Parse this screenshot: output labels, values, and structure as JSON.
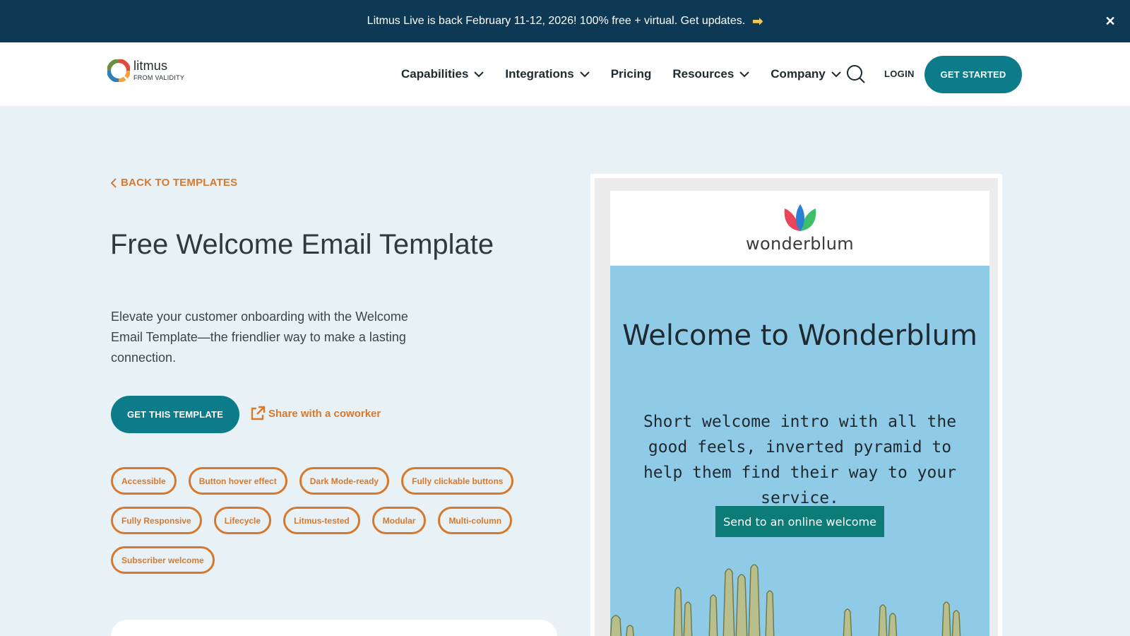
{
  "announcement": {
    "text": "Litmus Live is back February 11-12, 2026! 100% free + virtual. Get updates.",
    "arrow": "➡",
    "close": "✕"
  },
  "header": {
    "logo_name": "litmus",
    "logo_sub": "FROM VALIDITY",
    "nav": [
      {
        "label": "Capabilities",
        "dropdown": true
      },
      {
        "label": "Integrations",
        "dropdown": true
      },
      {
        "label": "Pricing",
        "dropdown": false
      },
      {
        "label": "Resources",
        "dropdown": true
      },
      {
        "label": "Company",
        "dropdown": true
      }
    ],
    "login": "LOGIN",
    "get_started": "GET STARTED"
  },
  "main": {
    "back_link": "BACK TO TEMPLATES",
    "title": "Free Welcome Email Template",
    "description": "Elevate your customer onboarding with the Welcome Email Template—the friendlier way to make a lasting connection.",
    "cta": "GET THIS TEMPLATE",
    "share": "Share with a coworker",
    "tags": [
      [
        "Accessible",
        "Button hover effect",
        "Dark Mode-ready",
        "Fully clickable buttons"
      ],
      [
        "Fully Responsive",
        "Lifecycle",
        "Litmus-tested",
        "Modular",
        "Multi-column"
      ],
      [
        "Subscriber welcome"
      ]
    ]
  },
  "preview": {
    "brand": "wonderblum",
    "title": "Welcome to Wonderblum",
    "intro": "Short welcome intro with all the good feels, inverted pyramid to help them find their way to your service.",
    "button": "Send to an online welcome"
  },
  "colors": {
    "announce_bg": "#0e3954",
    "accent_teal": "#0d7c8a",
    "accent_orange": "#d6782e",
    "page_bg": "#e8f2f6",
    "email_sky": "#8fcbe6"
  }
}
